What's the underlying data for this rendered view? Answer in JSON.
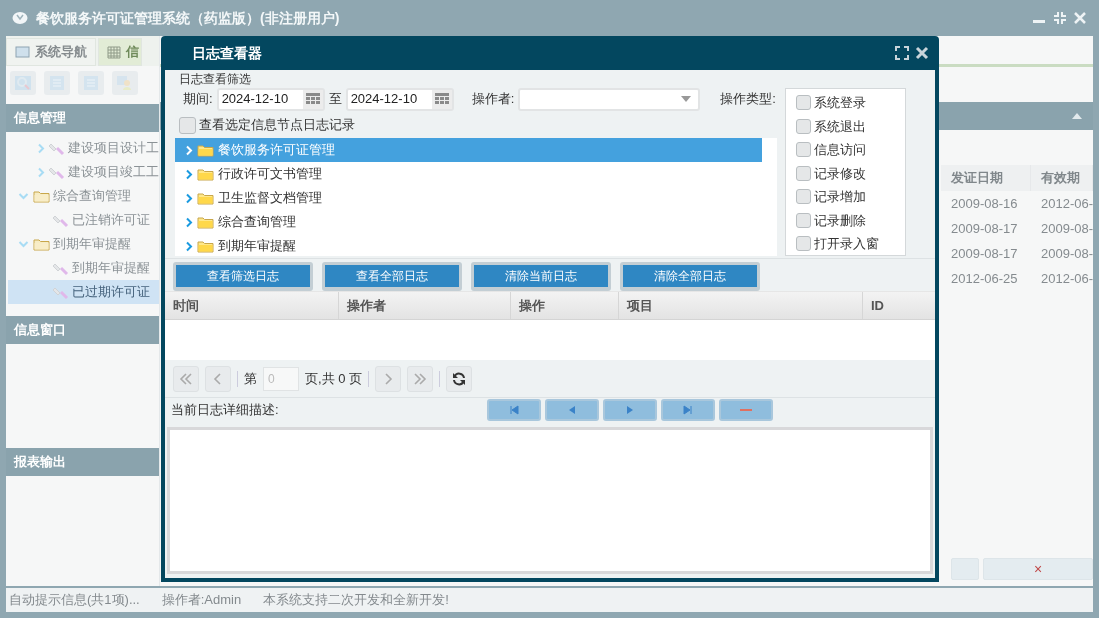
{
  "app": {
    "title": "餐饮服务许可证管理系统（药监版）(非注册用户)"
  },
  "nav_tabs": [
    {
      "label": "系统导航",
      "selected": false
    },
    {
      "label": "信",
      "selected": true
    }
  ],
  "sidebar": {
    "sections": [
      {
        "title": "信息管理",
        "tree": [
          {
            "children": [
              {
                "label": "建设项目设计工",
                "kind": "item",
                "expanded": false,
                "selected": false
              },
              {
                "label": "建设项目竣工工",
                "kind": "item",
                "expanded": false,
                "selected": false
              }
            ]
          },
          {
            "label": "综合查询管理",
            "kind": "folder",
            "expanded": true,
            "selected": false,
            "children": [
              {
                "label": "已注销许可证",
                "kind": "item",
                "selected": false
              }
            ]
          },
          {
            "label": "到期年审提醒",
            "kind": "folder",
            "expanded": true,
            "selected": false,
            "children": [
              {
                "label": "到期年审提醒",
                "kind": "item",
                "selected": false
              },
              {
                "label": "已过期许可证",
                "kind": "item",
                "selected": true
              }
            ]
          }
        ]
      },
      {
        "title": "信息窗口"
      },
      {
        "title": "报表输出"
      }
    ]
  },
  "table": {
    "columns": [
      "发证日期",
      "有效期"
    ],
    "rows": [
      [
        "2009-08-16",
        "2012-06-"
      ],
      [
        "2009-08-17",
        "2009-08-"
      ],
      [
        "2009-08-17",
        "2009-08-"
      ],
      [
        "2012-06-25",
        "2012-06-"
      ]
    ],
    "close_button": "×"
  },
  "status_bar": [
    "自动提示信息(共1项)...",
    "操作者:Admin",
    "本系统支持二次开发和全新开发!"
  ],
  "dialog": {
    "title": "日志查看器",
    "legend": "日志查看筛选",
    "period_label": "期间:",
    "date_from": "2024-12-10",
    "to_label": "至",
    "date_to": "2024-12-10",
    "operator_label": "操作者:",
    "op_type_label": "操作类型:",
    "op_types": [
      {
        "label": "系统登录",
        "checked": false
      },
      {
        "label": "系统退出",
        "checked": false
      },
      {
        "label": "信息访问",
        "checked": false
      },
      {
        "label": "记录修改",
        "checked": false
      },
      {
        "label": "记录增加",
        "checked": false
      },
      {
        "label": "记录删除",
        "checked": false
      },
      {
        "label": "打开录入窗",
        "checked": false
      }
    ],
    "node_filter": {
      "label": "查看选定信息节点日志记录",
      "checked": false
    },
    "modules": [
      {
        "label": "餐饮服务许可证管理",
        "selected": true,
        "expanded": false
      },
      {
        "label": "行政许可文书管理",
        "selected": false,
        "expanded": false
      },
      {
        "label": "卫生监督文档管理",
        "selected": false,
        "expanded": false
      },
      {
        "label": "综合查询管理",
        "selected": false,
        "expanded": false
      },
      {
        "label": "到期年审提醒",
        "selected": false,
        "expanded": false
      }
    ],
    "buttons": [
      "查看筛选日志",
      "查看全部日志",
      "清除当前日志",
      "清除全部日志"
    ],
    "grid": {
      "columns": [
        "时间",
        "操作者",
        "操作",
        "项目",
        "ID"
      ]
    },
    "pager": {
      "page_label": "第",
      "page_value": "0",
      "total_text": "页,共 0 页"
    },
    "detail_label": "当前日志详细描述:"
  }
}
